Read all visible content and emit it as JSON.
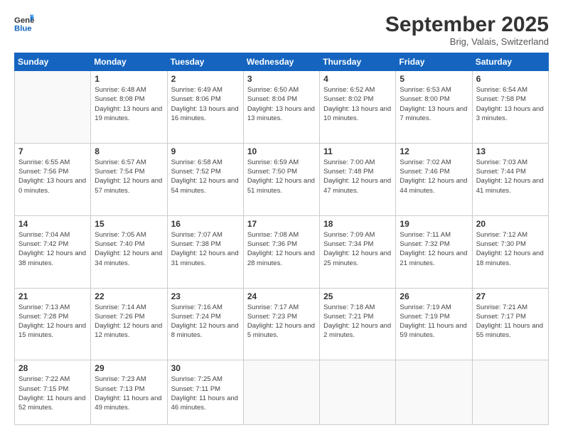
{
  "logo": {
    "line1": "General",
    "line2": "Blue"
  },
  "title": "September 2025",
  "location": "Brig, Valais, Switzerland",
  "weekdays": [
    "Sunday",
    "Monday",
    "Tuesday",
    "Wednesday",
    "Thursday",
    "Friday",
    "Saturday"
  ],
  "weeks": [
    [
      {
        "day": "",
        "info": ""
      },
      {
        "day": "1",
        "info": "Sunrise: 6:48 AM\nSunset: 8:08 PM\nDaylight: 13 hours\nand 19 minutes."
      },
      {
        "day": "2",
        "info": "Sunrise: 6:49 AM\nSunset: 8:06 PM\nDaylight: 13 hours\nand 16 minutes."
      },
      {
        "day": "3",
        "info": "Sunrise: 6:50 AM\nSunset: 8:04 PM\nDaylight: 13 hours\nand 13 minutes."
      },
      {
        "day": "4",
        "info": "Sunrise: 6:52 AM\nSunset: 8:02 PM\nDaylight: 13 hours\nand 10 minutes."
      },
      {
        "day": "5",
        "info": "Sunrise: 6:53 AM\nSunset: 8:00 PM\nDaylight: 13 hours\nand 7 minutes."
      },
      {
        "day": "6",
        "info": "Sunrise: 6:54 AM\nSunset: 7:58 PM\nDaylight: 13 hours\nand 3 minutes."
      }
    ],
    [
      {
        "day": "7",
        "info": "Sunrise: 6:55 AM\nSunset: 7:56 PM\nDaylight: 13 hours\nand 0 minutes."
      },
      {
        "day": "8",
        "info": "Sunrise: 6:57 AM\nSunset: 7:54 PM\nDaylight: 12 hours\nand 57 minutes."
      },
      {
        "day": "9",
        "info": "Sunrise: 6:58 AM\nSunset: 7:52 PM\nDaylight: 12 hours\nand 54 minutes."
      },
      {
        "day": "10",
        "info": "Sunrise: 6:59 AM\nSunset: 7:50 PM\nDaylight: 12 hours\nand 51 minutes."
      },
      {
        "day": "11",
        "info": "Sunrise: 7:00 AM\nSunset: 7:48 PM\nDaylight: 12 hours\nand 47 minutes."
      },
      {
        "day": "12",
        "info": "Sunrise: 7:02 AM\nSunset: 7:46 PM\nDaylight: 12 hours\nand 44 minutes."
      },
      {
        "day": "13",
        "info": "Sunrise: 7:03 AM\nSunset: 7:44 PM\nDaylight: 12 hours\nand 41 minutes."
      }
    ],
    [
      {
        "day": "14",
        "info": "Sunrise: 7:04 AM\nSunset: 7:42 PM\nDaylight: 12 hours\nand 38 minutes."
      },
      {
        "day": "15",
        "info": "Sunrise: 7:05 AM\nSunset: 7:40 PM\nDaylight: 12 hours\nand 34 minutes."
      },
      {
        "day": "16",
        "info": "Sunrise: 7:07 AM\nSunset: 7:38 PM\nDaylight: 12 hours\nand 31 minutes."
      },
      {
        "day": "17",
        "info": "Sunrise: 7:08 AM\nSunset: 7:36 PM\nDaylight: 12 hours\nand 28 minutes."
      },
      {
        "day": "18",
        "info": "Sunrise: 7:09 AM\nSunset: 7:34 PM\nDaylight: 12 hours\nand 25 minutes."
      },
      {
        "day": "19",
        "info": "Sunrise: 7:11 AM\nSunset: 7:32 PM\nDaylight: 12 hours\nand 21 minutes."
      },
      {
        "day": "20",
        "info": "Sunrise: 7:12 AM\nSunset: 7:30 PM\nDaylight: 12 hours\nand 18 minutes."
      }
    ],
    [
      {
        "day": "21",
        "info": "Sunrise: 7:13 AM\nSunset: 7:28 PM\nDaylight: 12 hours\nand 15 minutes."
      },
      {
        "day": "22",
        "info": "Sunrise: 7:14 AM\nSunset: 7:26 PM\nDaylight: 12 hours\nand 12 minutes."
      },
      {
        "day": "23",
        "info": "Sunrise: 7:16 AM\nSunset: 7:24 PM\nDaylight: 12 hours\nand 8 minutes."
      },
      {
        "day": "24",
        "info": "Sunrise: 7:17 AM\nSunset: 7:23 PM\nDaylight: 12 hours\nand 5 minutes."
      },
      {
        "day": "25",
        "info": "Sunrise: 7:18 AM\nSunset: 7:21 PM\nDaylight: 12 hours\nand 2 minutes."
      },
      {
        "day": "26",
        "info": "Sunrise: 7:19 AM\nSunset: 7:19 PM\nDaylight: 11 hours\nand 59 minutes."
      },
      {
        "day": "27",
        "info": "Sunrise: 7:21 AM\nSunset: 7:17 PM\nDaylight: 11 hours\nand 55 minutes."
      }
    ],
    [
      {
        "day": "28",
        "info": "Sunrise: 7:22 AM\nSunset: 7:15 PM\nDaylight: 11 hours\nand 52 minutes."
      },
      {
        "day": "29",
        "info": "Sunrise: 7:23 AM\nSunset: 7:13 PM\nDaylight: 11 hours\nand 49 minutes."
      },
      {
        "day": "30",
        "info": "Sunrise: 7:25 AM\nSunset: 7:11 PM\nDaylight: 11 hours\nand 46 minutes."
      },
      {
        "day": "",
        "info": ""
      },
      {
        "day": "",
        "info": ""
      },
      {
        "day": "",
        "info": ""
      },
      {
        "day": "",
        "info": ""
      }
    ]
  ]
}
